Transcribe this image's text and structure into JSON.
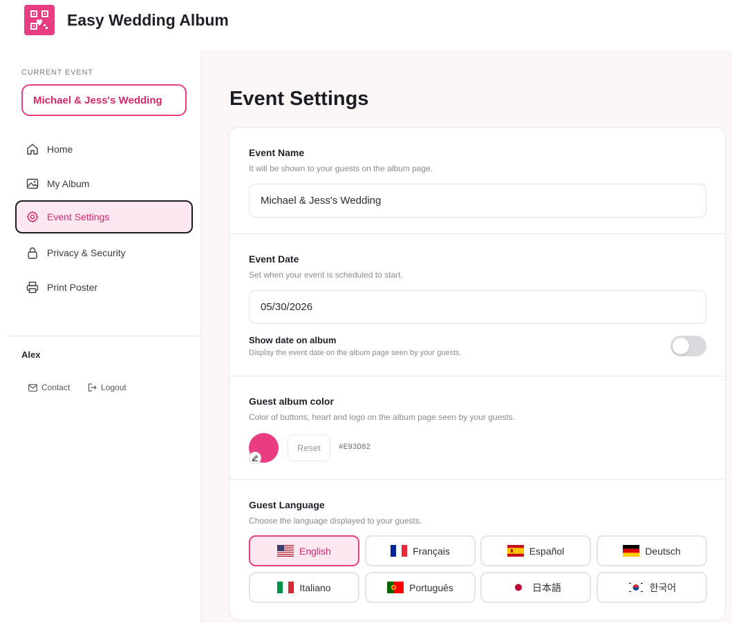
{
  "app": {
    "title": "Easy Wedding Album"
  },
  "sidebar": {
    "current_event_label": "CURRENT EVENT",
    "current_event": "Michael & Jess's Wedding",
    "items": [
      {
        "label": "Home",
        "icon": "home-icon"
      },
      {
        "label": "My Album",
        "icon": "image-icon"
      },
      {
        "label": "Event Settings",
        "icon": "gear-icon",
        "active": true
      },
      {
        "label": "Privacy & Security",
        "icon": "lock-icon"
      },
      {
        "label": "Print Poster",
        "icon": "printer-icon"
      }
    ],
    "user": "Alex",
    "contact_label": "Contact",
    "logout_label": "Logout"
  },
  "page": {
    "title": "Event Settings"
  },
  "event_name": {
    "title": "Event Name",
    "desc": "It will be shown to your guests on the album page.",
    "value": "Michael & Jess's Wedding"
  },
  "event_date": {
    "title": "Event Date",
    "desc": "Set when your event is scheduled to start.",
    "value": "05/30/2026",
    "show_title": "Show date on album",
    "show_desc": "Display the event date on the album page seen by your guests.",
    "show_enabled": false
  },
  "album_color": {
    "title": "Guest album color",
    "desc": "Color of buttons, heart and logo on the album page seen by your guests.",
    "reset_label": "Reset",
    "hex": "#E93D82"
  },
  "language": {
    "title": "Guest Language",
    "desc": "Choose the language displayed to your guests.",
    "options": [
      {
        "label": "English",
        "flag": "us-flag-icon",
        "selected": true
      },
      {
        "label": "Français",
        "flag": "fr-flag-icon"
      },
      {
        "label": "Español",
        "flag": "es-flag-icon"
      },
      {
        "label": "Deutsch",
        "flag": "de-flag-icon"
      },
      {
        "label": "Italiano",
        "flag": "it-flag-icon"
      },
      {
        "label": "Português",
        "flag": "pt-flag-icon"
      },
      {
        "label": "日本語",
        "flag": "jp-flag-icon"
      },
      {
        "label": "한국어",
        "flag": "kr-flag-icon"
      }
    ]
  },
  "colors": {
    "accent": "#e93d82",
    "accent_text": "#d5286c",
    "active_bg": "#fde7f1",
    "main_bg": "#fdf6f6"
  }
}
